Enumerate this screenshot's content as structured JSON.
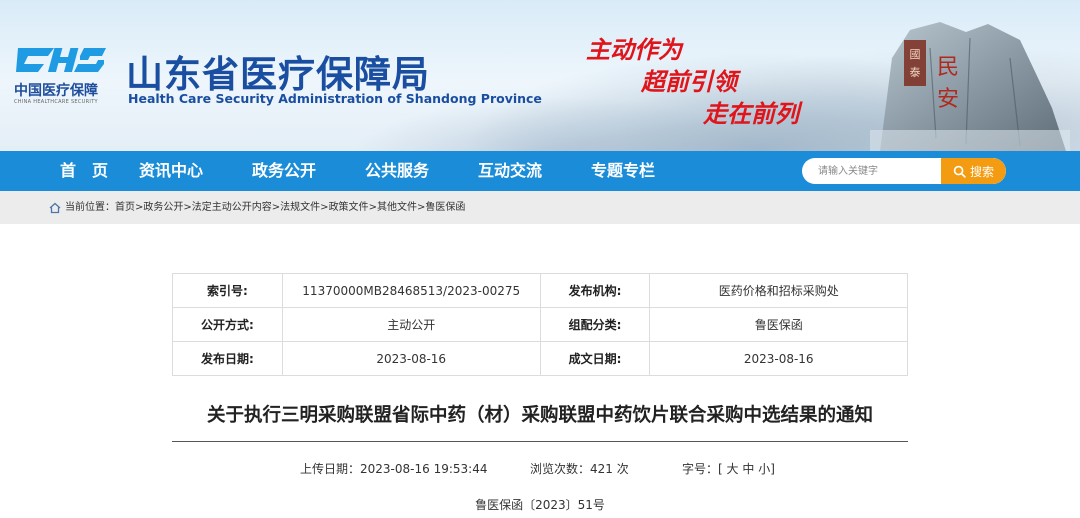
{
  "header": {
    "logo_mark": "CHS",
    "logo_cn": "中国医疗保障",
    "logo_en": "CHINA HEALTHCARE SECURITY",
    "title": "山东省医疗保障局",
    "subtitle": "Health Care Security Administration of Shandong Province",
    "slogans": [
      "主动作为",
      "超前引领",
      "走在前列"
    ],
    "colors": {
      "title": "#1a4ea0",
      "slogan": "#e0141b",
      "nav": "#1b8cd7",
      "search_button": "#f39c12"
    }
  },
  "nav": {
    "items": [
      "首　页",
      "资讯中心",
      "政务公开",
      "公共服务",
      "互动交流",
      "专题专栏"
    ],
    "search_placeholder": "请输入关键字",
    "search_label": "搜索",
    "search_icon": "search-icon"
  },
  "breadcrumb": {
    "prefix": "当前位置：",
    "items": [
      "首页",
      "政务公开",
      "法定主动公开内容",
      "法规文件",
      "政策文件",
      "其他文件",
      "鲁医保函"
    ],
    "separator": ">"
  },
  "info": {
    "rows": [
      {
        "k1": "索引号:",
        "v1": "11370000MB28468513/2023-00275",
        "k2": "发布机构:",
        "v2": "医药价格和招标采购处"
      },
      {
        "k1": "公开方式:",
        "v1": "主动公开",
        "k2": "组配分类:",
        "v2": "鲁医保函"
      },
      {
        "k1": "发布日期:",
        "v1": "2023-08-16",
        "k2": "成文日期:",
        "v2": "2023-08-16"
      }
    ]
  },
  "article": {
    "title": "关于执行三明采购联盟省际中药（材）采购联盟中药饮片联合采购中选结果的通知",
    "upload_label": "上传日期：",
    "upload_value": "2023-08-16 19:53:44",
    "views_label": "浏览次数：",
    "views_value": "421",
    "views_unit": "次",
    "font_label": "字号：",
    "font_sizes": [
      "大",
      "中",
      "小"
    ],
    "doc_number": "鲁医保函〔2023〕51号"
  }
}
